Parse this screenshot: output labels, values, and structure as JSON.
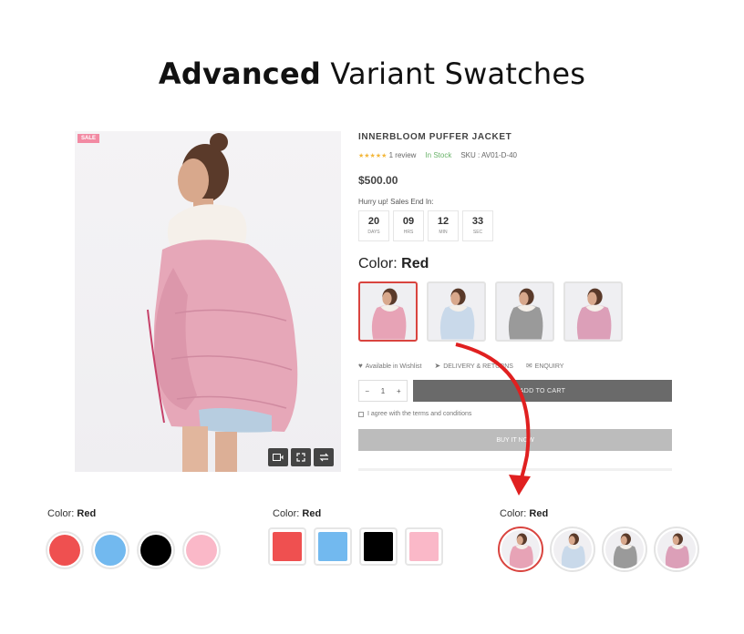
{
  "headline": {
    "bold": "Advanced",
    "light": "Variant Swatches"
  },
  "product": {
    "sale_badge": "SALE",
    "title": "INNERBLOOM PUFFER JACKET",
    "stars": "★★★★★",
    "reviews": "1 review",
    "stock": "In Stock",
    "sku": "SKU : AV01-D-40",
    "price": "$500.00",
    "hurry": "Hurry up! Sales End In:",
    "countdown": [
      {
        "num": "20",
        "label": "DAYS"
      },
      {
        "num": "09",
        "label": "HRS"
      },
      {
        "num": "12",
        "label": "MIN"
      },
      {
        "num": "33",
        "label": "SEC"
      }
    ],
    "color_label": "Color:",
    "color_value": "Red",
    "thumbs": [
      {
        "jacket": "#e7a3b6",
        "active": true
      },
      {
        "jacket": "#c9d9ea",
        "active": false
      },
      {
        "jacket": "#9a9a9a",
        "active": false
      },
      {
        "jacket": "#dc9fb8",
        "active": false
      }
    ],
    "actions": {
      "wishlist": "Available in Wishlist",
      "delivery": "DELIVERY & RETURNS",
      "enquiry": "ENQUIRY"
    },
    "qty": {
      "minus": "−",
      "value": "1",
      "plus": "+"
    },
    "add_to_cart": "ADD TO CART",
    "agree": "I agree with the terms and conditions",
    "buy_now": "BUY IT NOW",
    "icons": {
      "video": "video-icon",
      "expand": "expand-icon",
      "compare": "compare-icon"
    }
  },
  "swatch_groups": [
    {
      "label": "Color:",
      "value": "Red",
      "style": "circle",
      "colors": [
        "#ef5050",
        "#72b9ef",
        "#000000",
        "#fab8c8"
      ]
    },
    {
      "label": "Color:",
      "value": "Red",
      "style": "square",
      "colors": [
        "#ef5050",
        "#72b9ef",
        "#000000",
        "#fab8c8"
      ]
    },
    {
      "label": "Color:",
      "value": "Red",
      "style": "image-circle",
      "jackets": [
        "#e7a3b6",
        "#c9d9ea",
        "#9a9a9a",
        "#dc9fb8"
      ]
    }
  ],
  "accent_color": "#d9443f"
}
